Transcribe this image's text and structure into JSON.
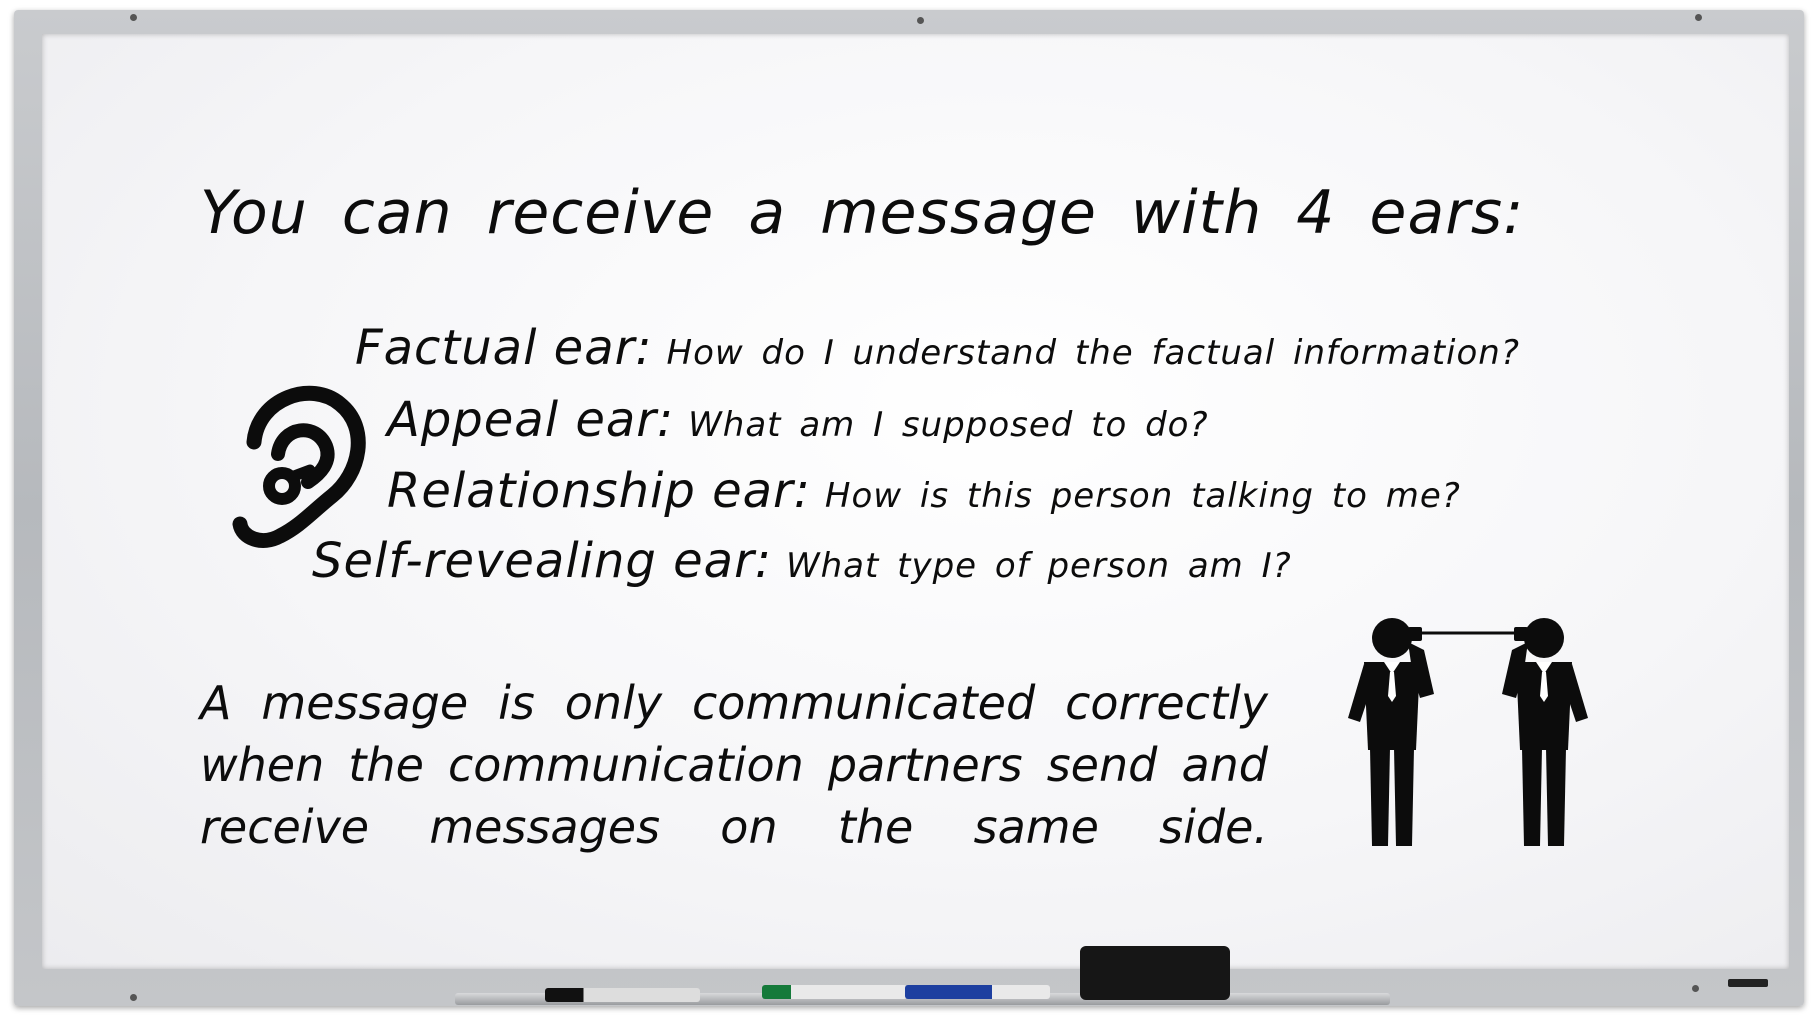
{
  "title": "You can receive a message with 4 ears:",
  "ears": [
    {
      "name": "Factual ear:",
      "question": "How do I understand the factual information?"
    },
    {
      "name": "Appeal ear:",
      "question": "What am I supposed to do?"
    },
    {
      "name": "Relationship ear:",
      "question": "How is this person talking to me?"
    },
    {
      "name": "Self-revealing ear:",
      "question": "What type of person am I?"
    }
  ],
  "summary": {
    "line1": "A message is only communicated correctly",
    "line2": "when the communication partners send and",
    "line3": "receive messages on the same side."
  },
  "icons": {
    "ear": "ear-icon",
    "people": "two-businessmen-tin-can-phone-icon"
  },
  "colors": {
    "text": "#0c0c0c",
    "board": "#f7f7f9",
    "frame": "#bfc1c4"
  }
}
